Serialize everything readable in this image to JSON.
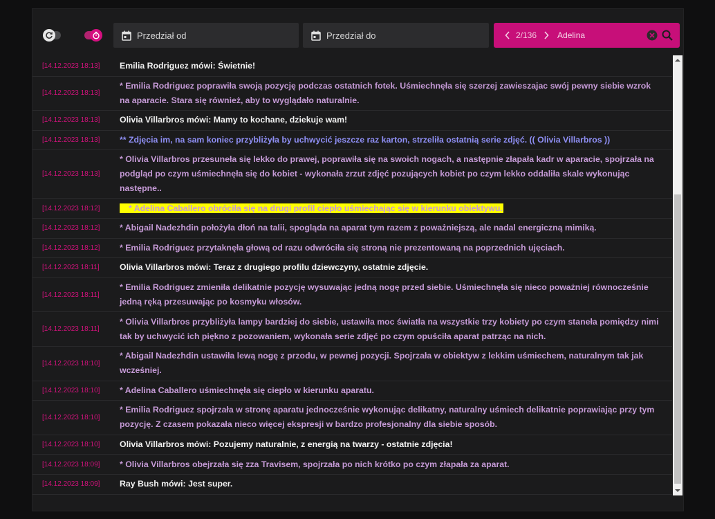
{
  "toolbar": {
    "date_from_placeholder": "Przedział od",
    "date_to_placeholder": "Przedział do",
    "search": {
      "counter": "2/136",
      "query": "Adelina"
    },
    "toggles": {
      "auto_refresh": false,
      "timer": true
    }
  },
  "log": [
    {
      "ts": "[14.12.2023 18:13]",
      "text": "Emilia Rodriguez mówi: Świetnie!"
    },
    {
      "ts": "[14.12.2023 18:13]",
      "text": "* Emilia Rodriguez poprawiła swoją pozycję podczas ostatnich fotek. Uśmiechnęła się szerzej zawieszajac swój pewny siebie wzrok na aparacie. Stara się również, aby to wyglądało naturalnie."
    },
    {
      "ts": "[14.12.2023 18:13]",
      "text": "Olivia Villarbros mówi: Mamy to kochane, dziekuje wam!"
    },
    {
      "ts": "[14.12.2023 18:13]",
      "text": "** Zdjęcia im, na sam koniec przybliżyła by uchwycić jeszcze raz karton, strzeliła ostatnią serie zdjęć. (( Olivia Villarbros ))"
    },
    {
      "ts": "[14.12.2023 18:13]",
      "text": "* Olivia Villarbros przesuneła się lekko do prawej, poprawiła się na swoich nogach, a następnie złapała kadr w aparacie, spojrzała na podgląd po czym uśmiechnęła się do kobiet - wykonała zrzut zdjęć pozujących kobiet po czym lekko oddaliła skale wykonując następne.."
    },
    {
      "ts": "[14.12.2023 18:12]",
      "text": "* Adelina Caballero obróciła się na drugi profil ciepło uśmiechając się w kierunku obiektywu."
    },
    {
      "ts": "[14.12.2023 18:12]",
      "text": "* Abigail Nadezhdin położyła dłoń na talii, spogląda na aparat tym razem z poważniejszą, ale nadal energiczną mimiką."
    },
    {
      "ts": "[14.12.2023 18:12]",
      "text": "* Emilia Rodriguez przytaknęła głową od razu odwróciła się stroną nie prezentowaną na poprzednich ujęciach."
    },
    {
      "ts": "[14.12.2023 18:11]",
      "text": "Olivia Villarbros mówi: Teraz z drugiego profilu dziewczyny, ostatnie zdjęcie."
    },
    {
      "ts": "[14.12.2023 18:11]",
      "text": "* Emilia Rodriguez zmieniła delikatnie pozycję wysuwając jedną nogę przed siebie. Uśmiechnęła się nieco poważniej równocześnie jedną ręką przesuwając po kosmyku włosów."
    },
    {
      "ts": "[14.12.2023 18:11]",
      "text": "* Olivia Villarbros przybliżyła lampy bardziej do siebie, ustawiła moc światła na wszystkie trzy kobiety po czym staneła pomiędzy nimi tak by uchwycić ich piękno z pozowaniem, wykonała serie zdjęć po czym opuściła aparat patrząc na nich."
    },
    {
      "ts": "[14.12.2023 18:10]",
      "text": "* Abigail Nadezhdin ustawiła lewą nogę z przodu, w pewnej pozycji. Spojrzała w obiektyw z lekkim uśmiechem, naturalnym tak jak wcześniej."
    },
    {
      "ts": "[14.12.2023 18:10]",
      "text": "* Adelina Caballero uśmiechnęła się ciepło w kierunku aparatu."
    },
    {
      "ts": "[14.12.2023 18:10]",
      "text": "* Emilia Rodriguez spojrzała w stronę aparatu jednocześnie wykonując delikatny, naturalny uśmiech delikatnie poprawiając przy tym pozycję. Z czasem pokazała nieco więcej ekspresji w bardzo profesjonalny dla siebie sposób."
    },
    {
      "ts": "[14.12.2023 18:10]",
      "text": "Olivia Villarbros mówi: Pozujemy naturalnie, z energią na twarzy - ostatnie zdjęcia!"
    },
    {
      "ts": "[14.12.2023 18:09]",
      "text": "* Olivia Villarbros obejrzała się zza Travisem, spojrzała po nich krótko po czym złapała za aparat."
    },
    {
      "ts": "[14.12.2023 18:09]",
      "text": "Ray Bush mówi: Jest super."
    }
  ],
  "colors": {
    "accent": "#c70f79",
    "timestamp": "#d2127c",
    "speech": "#f2f2f2",
    "emote": "#c59ad6",
    "do": "#8f8ff5",
    "highlight": "#ffff00"
  },
  "icons": [
    "refresh-icon",
    "timer-icon",
    "calendar-icon",
    "chevron-left-icon",
    "chevron-right-icon",
    "clear-icon",
    "search-icon"
  ]
}
